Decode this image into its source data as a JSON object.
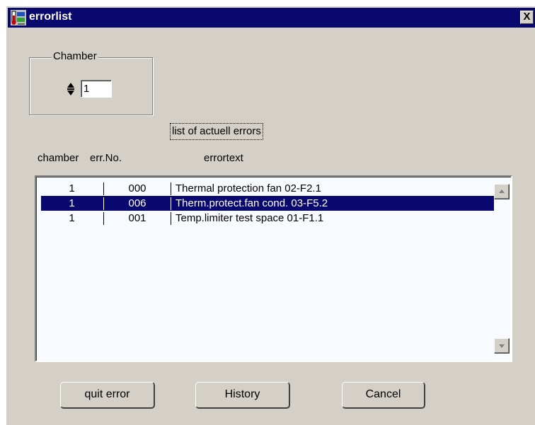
{
  "window": {
    "title": "errorlist",
    "close_label": "X"
  },
  "chamber": {
    "group_label": "Chamber",
    "value": "1"
  },
  "list": {
    "caption": "list of actuell errors",
    "columns": [
      "chamber",
      "err.No.",
      "errortext"
    ],
    "rows": [
      {
        "chamber": "1",
        "err_no": "000",
        "text": "Thermal protection fan  02-F2.1",
        "selected": false
      },
      {
        "chamber": "1",
        "err_no": "006",
        "text": "Therm.protect.fan cond. 03-F5.2",
        "selected": true
      },
      {
        "chamber": "1",
        "err_no": "001",
        "text": "Temp.limiter test space 01-F1.1",
        "selected": false
      }
    ]
  },
  "buttons": {
    "quit": "quit error",
    "history": "History",
    "cancel": "Cancel"
  },
  "colors": {
    "titlebar": "#08086e",
    "selection": "#08086e",
    "face": "#d4d0c8",
    "list_bg": "#f7fbff"
  },
  "icons": {
    "app": "thermometer-app-icon",
    "spinner": "spin-up-down-icon",
    "scroll_up": "arrow-up-icon",
    "scroll_down": "arrow-down-icon"
  }
}
